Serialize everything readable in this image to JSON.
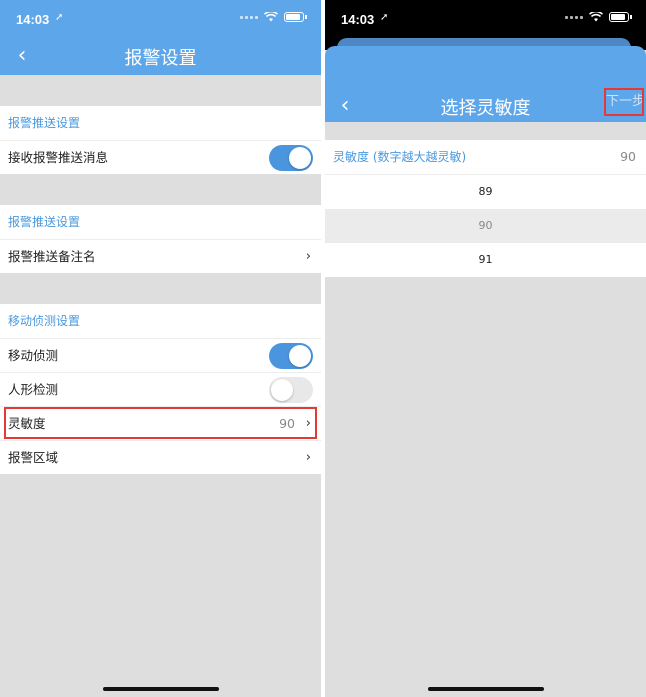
{
  "left": {
    "status": {
      "time": "14:03",
      "arrow": "➚"
    },
    "nav": {
      "back": "‹",
      "title": "报警设置"
    },
    "sections": [
      {
        "title": "报警推送设置",
        "rows": [
          {
            "label": "接收报警推送消息",
            "toggle": "on"
          }
        ]
      },
      {
        "title": "报警推送设置",
        "rows": [
          {
            "label": "报警推送备注名"
          }
        ]
      },
      {
        "title": "移动侦测设置",
        "rows": [
          {
            "label": "移动侦测",
            "toggle": "on"
          },
          {
            "label": "人形检测",
            "toggle": "off"
          },
          {
            "label": "灵敏度",
            "value": "90"
          },
          {
            "label": "报警区域"
          }
        ]
      }
    ],
    "chevron": "›"
  },
  "right": {
    "status": {
      "time": "14:03",
      "arrow": "➚"
    },
    "nav": {
      "back": "‹",
      "title": "选择灵敏度",
      "next": "下一步"
    },
    "list": {
      "header_label": "灵敏度 (数字越大越灵敏)",
      "header_value": "90",
      "options": [
        "89",
        "90",
        "91"
      ],
      "selected": "90"
    }
  },
  "colors": {
    "accent": "#5da6ea",
    "toggle_on": "#4a95de",
    "highlight": "#e53935",
    "section_title": "#4a98de"
  },
  "icons": [
    "back-chevron-icon",
    "chevron-right-icon",
    "wifi-icon",
    "battery-icon",
    "signal-icon",
    "location-arrow-icon"
  ]
}
